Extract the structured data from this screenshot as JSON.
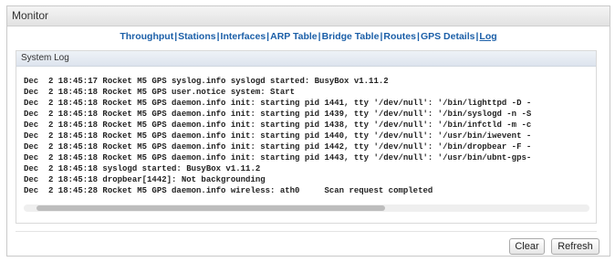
{
  "panel": {
    "title": "Monitor"
  },
  "nav": {
    "items": [
      {
        "label": "Throughput",
        "active": false
      },
      {
        "label": "Stations",
        "active": false
      },
      {
        "label": "Interfaces",
        "active": false
      },
      {
        "label": "ARP Table",
        "active": false
      },
      {
        "label": "Bridge Table",
        "active": false
      },
      {
        "label": "Routes",
        "active": false
      },
      {
        "label": "GPS Details",
        "active": false
      },
      {
        "label": "Log",
        "active": true
      }
    ],
    "separator": "|"
  },
  "log": {
    "title": "System Log",
    "lines": [
      "Dec  2 18:45:17 Rocket M5 GPS syslog.info syslogd started: BusyBox v1.11.2",
      "Dec  2 18:45:18 Rocket M5 GPS user.notice system: Start",
      "Dec  2 18:45:18 Rocket M5 GPS daemon.info init: starting pid 1441, tty '/dev/null': '/bin/lighttpd -D -",
      "Dec  2 18:45:18 Rocket M5 GPS daemon.info init: starting pid 1439, tty '/dev/null': '/bin/syslogd -n -S",
      "Dec  2 18:45:18 Rocket M5 GPS daemon.info init: starting pid 1438, tty '/dev/null': '/bin/infctld -m -c",
      "Dec  2 18:45:18 Rocket M5 GPS daemon.info init: starting pid 1440, tty '/dev/null': '/usr/bin/iwevent -",
      "Dec  2 18:45:18 Rocket M5 GPS daemon.info init: starting pid 1442, tty '/dev/null': '/bin/dropbear -F -",
      "Dec  2 18:45:18 Rocket M5 GPS daemon.info init: starting pid 1443, tty '/dev/null': '/usr/bin/ubnt-gps-",
      "Dec  2 18:45:18 syslogd started: BusyBox v1.11.2",
      "Dec  2 18:45:18 dropbear[1442]: Not backgrounding",
      "Dec  2 18:45:28 Rocket M5 GPS daemon.info wireless: ath0     Scan request completed"
    ]
  },
  "buttons": {
    "clear": "Clear",
    "refresh": "Refresh"
  }
}
